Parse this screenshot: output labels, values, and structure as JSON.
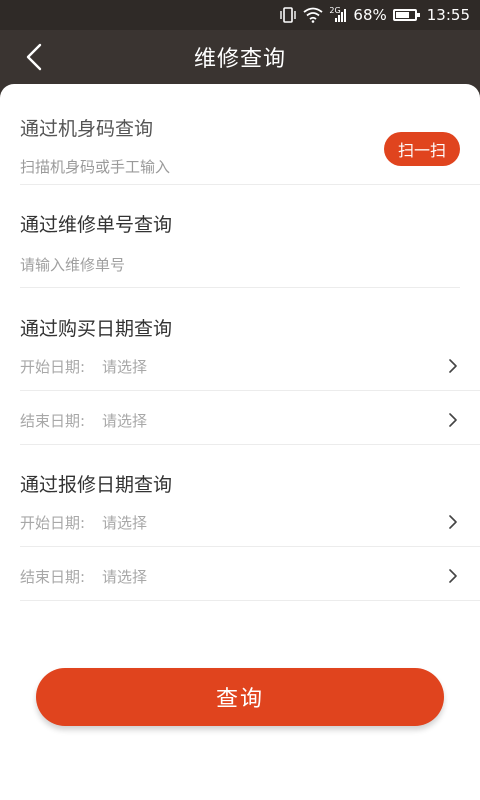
{
  "status_bar": {
    "network": "2G",
    "battery": "68%",
    "battery_level": 0.68,
    "time": "13:55"
  },
  "nav": {
    "back_icon": "chevron-left-icon",
    "title": "维修查询"
  },
  "serial_section": {
    "title": "通过机身码查询",
    "hint": "扫描机身码或手工输入",
    "scan_label": "扫一扫"
  },
  "order_section": {
    "title": "通过维修单号查询",
    "placeholder": "请输入维修单号"
  },
  "purchase_section": {
    "title": "通过购买日期查询",
    "start_label": "开始日期:",
    "start_value": "请选择",
    "end_label": "结束日期:",
    "end_value": "请选择"
  },
  "repair_section": {
    "title": "通过报修日期查询",
    "start_label": "开始日期:",
    "start_value": "请选择",
    "end_label": "结束日期:",
    "end_value": "请选择"
  },
  "query_button": {
    "label": "查询"
  },
  "colors": {
    "accent": "#e0441e",
    "nav_bg": "#3a3431",
    "status_bg": "#2f2a27"
  }
}
